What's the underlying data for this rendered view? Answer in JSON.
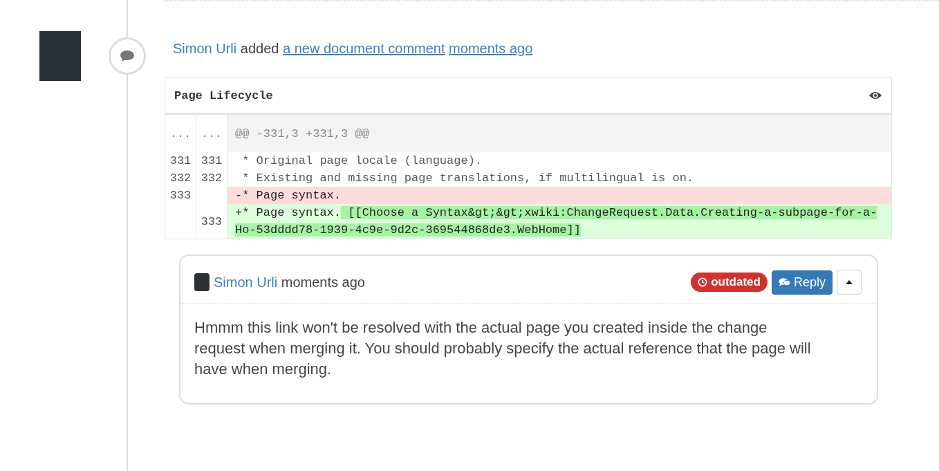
{
  "activity": {
    "author": "Simon Urli",
    "action": "added",
    "target_link": "a new document comment",
    "time_link": "moments ago"
  },
  "diff": {
    "title": "Page Lifecycle",
    "lines": [
      {
        "kind": "hunk",
        "old": "...",
        "new": "...",
        "text": "@@ -331,3 +331,3 @@"
      },
      {
        "kind": "context",
        "old": "331",
        "new": "331",
        "text": " * Original page locale (language)."
      },
      {
        "kind": "context",
        "old": "332",
        "new": "332",
        "text": " * Existing and missing page translations, if multilingual is on."
      },
      {
        "kind": "removed",
        "old": "333",
        "text": "-* Page syntax."
      },
      {
        "kind": "added",
        "new": "333",
        "text": "+* Page syntax.",
        "highlight": " [[Choose a Syntax&gt;&gt;xwiki:ChangeRequest.Data.Creating-a-subpage-for-a-Ho-53dddd78-1939-4c9e-9d2c-369544868de3.WebHome]]"
      }
    ]
  },
  "comment": {
    "author": "Simon Urli",
    "time": "moments ago",
    "outdated": true,
    "badge": "outdated",
    "reply_label": "Reply",
    "expanded": true,
    "body": "Hmmm this link won't be resolved with the actual page you created inside the change request when merging it. You should probably specify the actual reference that the page will have when merging."
  }
}
